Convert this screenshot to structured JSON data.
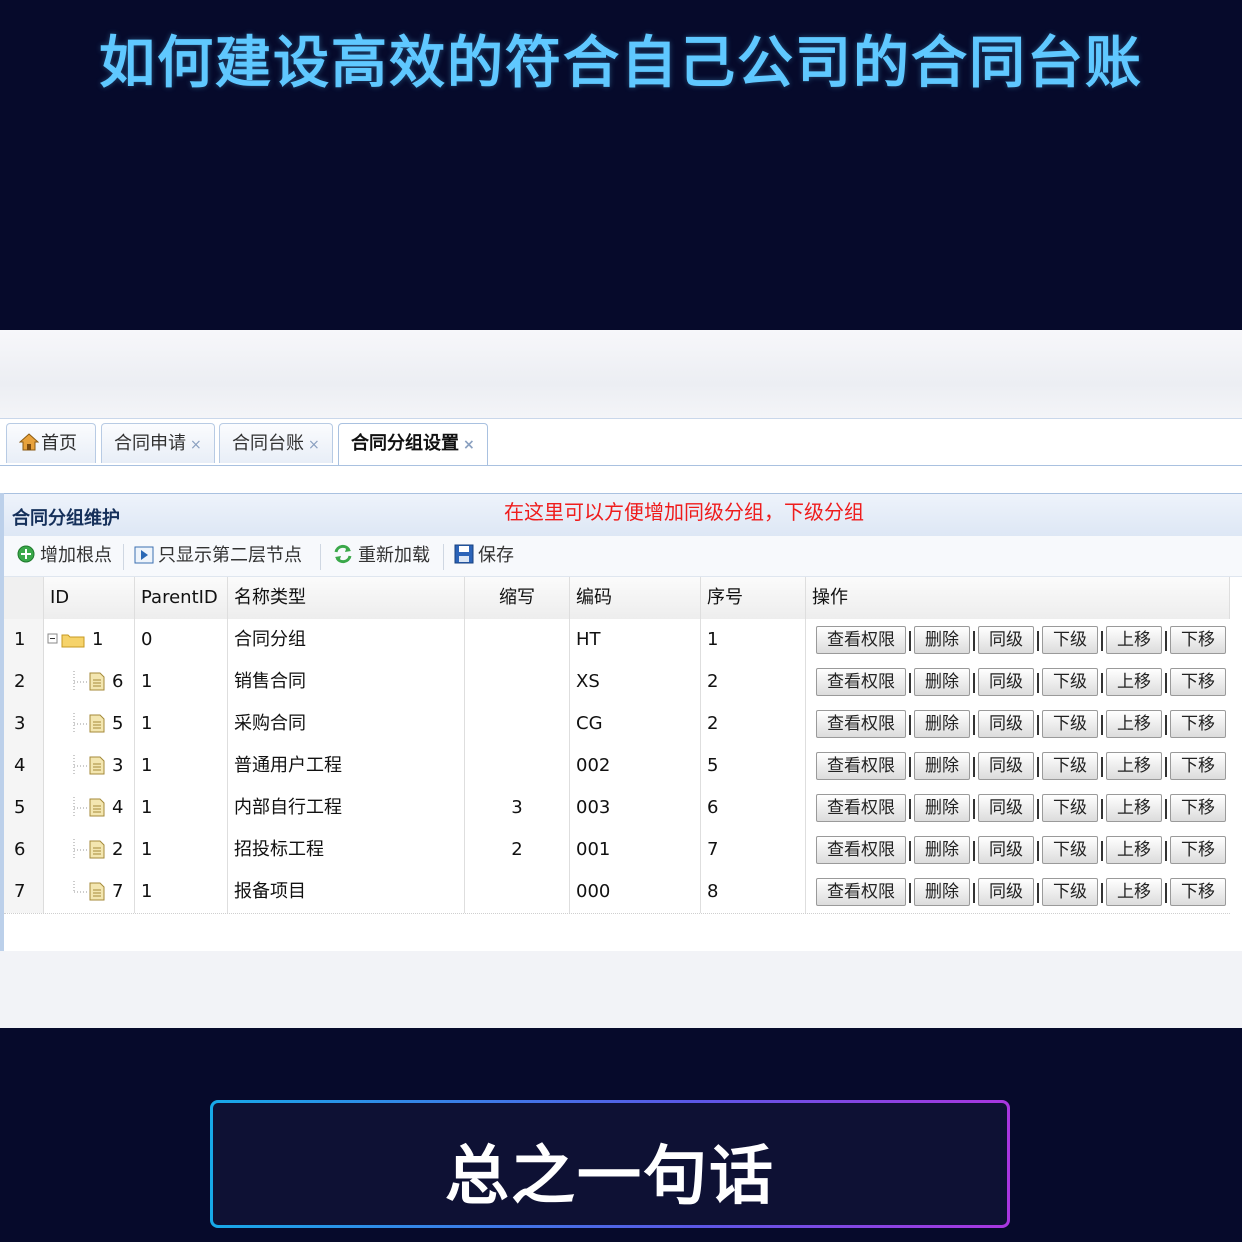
{
  "top_title": "如何建设高效的符合自己公司的合同台账",
  "tabs": [
    {
      "label": "首页",
      "closable": false
    },
    {
      "label": "合同申请",
      "closable": true
    },
    {
      "label": "合同台账",
      "closable": true
    },
    {
      "label": "合同分组设置",
      "closable": true,
      "active": true
    }
  ],
  "tab_close": "×",
  "panel": {
    "title": "合同分组维护",
    "annotation": "在这里可以方便增加同级分组，下级分组"
  },
  "toolbar": {
    "add_root": "增加根点",
    "show_second": "只显示第二层节点",
    "reload": "重新加载",
    "save": "保存"
  },
  "columns": {
    "id": "ID",
    "parent": "ParentID",
    "name": "名称类型",
    "abbr": "缩写",
    "code": "编码",
    "order": "序号",
    "ops": "操作"
  },
  "ops_labels": [
    "查看权限",
    "删除",
    "同级",
    "下级",
    "上移",
    "下移"
  ],
  "rows": [
    {
      "num": "1",
      "id": "1",
      "parent": "0",
      "name": "合同分组",
      "abbr": "",
      "code": "HT",
      "order": "1",
      "folder": true
    },
    {
      "num": "2",
      "id": "6",
      "parent": "1",
      "name": "销售合同",
      "abbr": "",
      "code": "XS",
      "order": "2"
    },
    {
      "num": "3",
      "id": "5",
      "parent": "1",
      "name": "采购合同",
      "abbr": "",
      "code": "CG",
      "order": "2"
    },
    {
      "num": "4",
      "id": "3",
      "parent": "1",
      "name": "普通用户工程",
      "abbr": "",
      "code": "002",
      "order": "5"
    },
    {
      "num": "5",
      "id": "4",
      "parent": "1",
      "name": "内部自行工程",
      "abbr": "3",
      "code": "003",
      "order": "6"
    },
    {
      "num": "6",
      "id": "2",
      "parent": "1",
      "name": "招投标工程",
      "abbr": "2",
      "code": "001",
      "order": "7"
    },
    {
      "num": "7",
      "id": "7",
      "parent": "1",
      "name": "报备项目",
      "abbr": "",
      "code": "000",
      "order": "8"
    }
  ],
  "caption": "总之一句话",
  "colors": {
    "title": "#5fc8ff",
    "annotation": "#ef1c1c",
    "background": "#060a2b"
  }
}
